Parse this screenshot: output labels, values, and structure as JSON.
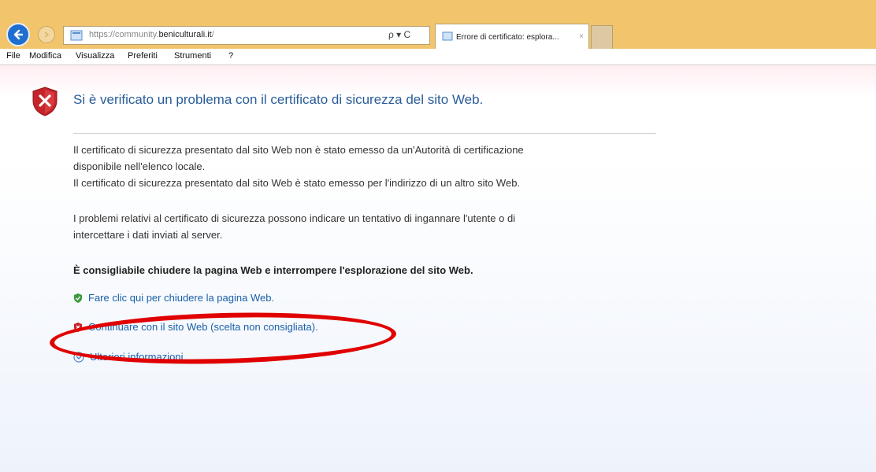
{
  "browser": {
    "url_prefix": "https://community.",
    "url_domain": "beniculturali.it",
    "url_suffix": "/",
    "address_tools": "ρ ▾ C",
    "tab_title": "Errore di certificato: esplora...",
    "tab_close": "×"
  },
  "menu": {
    "file": "File",
    "modifica": "Modifica",
    "visualizza": "Visualizza",
    "preferiti": "Preferiti",
    "strumenti": "Strumenti",
    "help": "?"
  },
  "page": {
    "heading": "Si è verificato un problema con il certificato di sicurezza del sito Web.",
    "para1_line1": "Il certificato di sicurezza presentato dal sito Web non è stato emesso da un'Autorità di certificazione",
    "para1_line2": "disponibile nell'elenco locale.",
    "para1_line3": "Il certificato di sicurezza presentato dal sito Web è stato emesso per l'indirizzo di un altro sito Web.",
    "para2_line1": "I problemi relativi al certificato di sicurezza possono indicare un tentativo di ingannare l'utente o di",
    "para2_line2": "intercettare i dati inviati al server.",
    "recommendation": "È consigliabile chiudere la pagina Web e interrompere l'esplorazione del sito Web.",
    "link_close": "Fare clic qui per chiudere la pagina Web.",
    "link_continue": "Continuare con il sito Web (scelta non consigliata).",
    "link_more": "Ulteriori informazioni"
  },
  "colors": {
    "titlebar": "#f2c46c",
    "heading": "#2a5c9a",
    "link": "#1a5fa8",
    "annotation": "#e00000"
  }
}
